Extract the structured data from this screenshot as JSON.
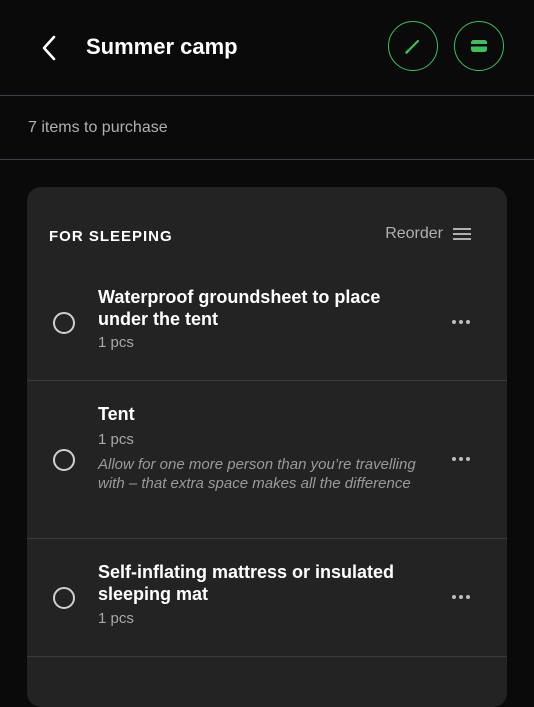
{
  "header": {
    "title": "Summer camp",
    "back_icon": "chevron-left-icon",
    "edit_icon": "pencil-icon",
    "card_icon": "credit-card-icon",
    "accent_color": "#3fbf5a"
  },
  "summary": {
    "text": "7 items to purchase"
  },
  "section": {
    "title": "FOR SLEEPING",
    "reorder_label": "Reorder",
    "reorder_icon": "menu-lines-icon"
  },
  "items": [
    {
      "name": "Waterproof groundsheet to place under the tent",
      "qty": "1 pcs",
      "note": "",
      "checked": false
    },
    {
      "name": "Tent",
      "qty": "1 pcs",
      "note": "Allow for one more person than you’re travelling with – that extra space makes all the difference",
      "checked": false
    },
    {
      "name": "Self-inflating mattress or insulated sleeping mat",
      "qty": "1 pcs",
      "note": "",
      "checked": false
    }
  ]
}
